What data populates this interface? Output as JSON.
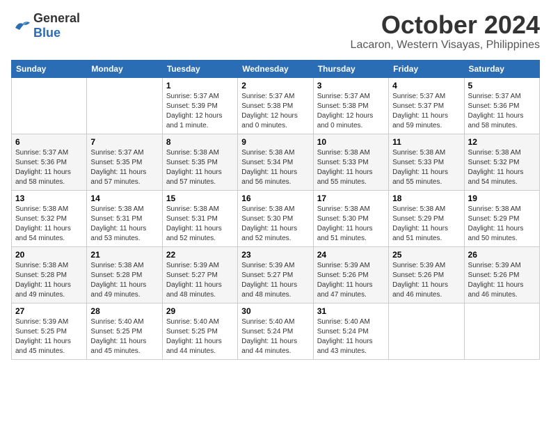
{
  "header": {
    "logo_general": "General",
    "logo_blue": "Blue",
    "month_title": "October 2024",
    "location": "Lacaron, Western Visayas, Philippines"
  },
  "days_of_week": [
    "Sunday",
    "Monday",
    "Tuesday",
    "Wednesday",
    "Thursday",
    "Friday",
    "Saturday"
  ],
  "weeks": [
    [
      {
        "day": "",
        "info": ""
      },
      {
        "day": "",
        "info": ""
      },
      {
        "day": "1",
        "info": "Sunrise: 5:37 AM\nSunset: 5:39 PM\nDaylight: 12 hours\nand 1 minute."
      },
      {
        "day": "2",
        "info": "Sunrise: 5:37 AM\nSunset: 5:38 PM\nDaylight: 12 hours\nand 0 minutes."
      },
      {
        "day": "3",
        "info": "Sunrise: 5:37 AM\nSunset: 5:38 PM\nDaylight: 12 hours\nand 0 minutes."
      },
      {
        "day": "4",
        "info": "Sunrise: 5:37 AM\nSunset: 5:37 PM\nDaylight: 11 hours\nand 59 minutes."
      },
      {
        "day": "5",
        "info": "Sunrise: 5:37 AM\nSunset: 5:36 PM\nDaylight: 11 hours\nand 58 minutes."
      }
    ],
    [
      {
        "day": "6",
        "info": "Sunrise: 5:37 AM\nSunset: 5:36 PM\nDaylight: 11 hours\nand 58 minutes."
      },
      {
        "day": "7",
        "info": "Sunrise: 5:37 AM\nSunset: 5:35 PM\nDaylight: 11 hours\nand 57 minutes."
      },
      {
        "day": "8",
        "info": "Sunrise: 5:38 AM\nSunset: 5:35 PM\nDaylight: 11 hours\nand 57 minutes."
      },
      {
        "day": "9",
        "info": "Sunrise: 5:38 AM\nSunset: 5:34 PM\nDaylight: 11 hours\nand 56 minutes."
      },
      {
        "day": "10",
        "info": "Sunrise: 5:38 AM\nSunset: 5:33 PM\nDaylight: 11 hours\nand 55 minutes."
      },
      {
        "day": "11",
        "info": "Sunrise: 5:38 AM\nSunset: 5:33 PM\nDaylight: 11 hours\nand 55 minutes."
      },
      {
        "day": "12",
        "info": "Sunrise: 5:38 AM\nSunset: 5:32 PM\nDaylight: 11 hours\nand 54 minutes."
      }
    ],
    [
      {
        "day": "13",
        "info": "Sunrise: 5:38 AM\nSunset: 5:32 PM\nDaylight: 11 hours\nand 54 minutes."
      },
      {
        "day": "14",
        "info": "Sunrise: 5:38 AM\nSunset: 5:31 PM\nDaylight: 11 hours\nand 53 minutes."
      },
      {
        "day": "15",
        "info": "Sunrise: 5:38 AM\nSunset: 5:31 PM\nDaylight: 11 hours\nand 52 minutes."
      },
      {
        "day": "16",
        "info": "Sunrise: 5:38 AM\nSunset: 5:30 PM\nDaylight: 11 hours\nand 52 minutes."
      },
      {
        "day": "17",
        "info": "Sunrise: 5:38 AM\nSunset: 5:30 PM\nDaylight: 11 hours\nand 51 minutes."
      },
      {
        "day": "18",
        "info": "Sunrise: 5:38 AM\nSunset: 5:29 PM\nDaylight: 11 hours\nand 51 minutes."
      },
      {
        "day": "19",
        "info": "Sunrise: 5:38 AM\nSunset: 5:29 PM\nDaylight: 11 hours\nand 50 minutes."
      }
    ],
    [
      {
        "day": "20",
        "info": "Sunrise: 5:38 AM\nSunset: 5:28 PM\nDaylight: 11 hours\nand 49 minutes."
      },
      {
        "day": "21",
        "info": "Sunrise: 5:38 AM\nSunset: 5:28 PM\nDaylight: 11 hours\nand 49 minutes."
      },
      {
        "day": "22",
        "info": "Sunrise: 5:39 AM\nSunset: 5:27 PM\nDaylight: 11 hours\nand 48 minutes."
      },
      {
        "day": "23",
        "info": "Sunrise: 5:39 AM\nSunset: 5:27 PM\nDaylight: 11 hours\nand 48 minutes."
      },
      {
        "day": "24",
        "info": "Sunrise: 5:39 AM\nSunset: 5:26 PM\nDaylight: 11 hours\nand 47 minutes."
      },
      {
        "day": "25",
        "info": "Sunrise: 5:39 AM\nSunset: 5:26 PM\nDaylight: 11 hours\nand 46 minutes."
      },
      {
        "day": "26",
        "info": "Sunrise: 5:39 AM\nSunset: 5:26 PM\nDaylight: 11 hours\nand 46 minutes."
      }
    ],
    [
      {
        "day": "27",
        "info": "Sunrise: 5:39 AM\nSunset: 5:25 PM\nDaylight: 11 hours\nand 45 minutes."
      },
      {
        "day": "28",
        "info": "Sunrise: 5:40 AM\nSunset: 5:25 PM\nDaylight: 11 hours\nand 45 minutes."
      },
      {
        "day": "29",
        "info": "Sunrise: 5:40 AM\nSunset: 5:25 PM\nDaylight: 11 hours\nand 44 minutes."
      },
      {
        "day": "30",
        "info": "Sunrise: 5:40 AM\nSunset: 5:24 PM\nDaylight: 11 hours\nand 44 minutes."
      },
      {
        "day": "31",
        "info": "Sunrise: 5:40 AM\nSunset: 5:24 PM\nDaylight: 11 hours\nand 43 minutes."
      },
      {
        "day": "",
        "info": ""
      },
      {
        "day": "",
        "info": ""
      }
    ]
  ]
}
